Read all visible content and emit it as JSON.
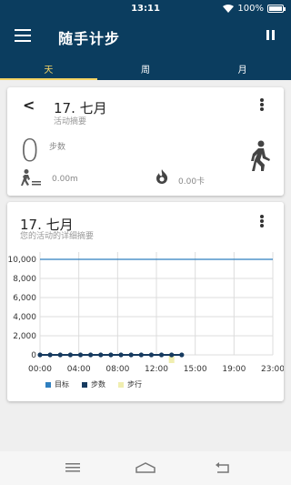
{
  "status": {
    "time": "13:11",
    "battery": "100%",
    "battery_level": 1.0
  },
  "app": {
    "title": "随手计步"
  },
  "tabs": [
    {
      "label": "天",
      "active": true
    },
    {
      "label": "周",
      "active": false
    },
    {
      "label": "月",
      "active": false
    }
  ],
  "summary": {
    "date": "17. 七月",
    "subtitle": "活动摘要",
    "steps": "0",
    "steps_unit": "步数",
    "distance": "0.00m",
    "calories": "0.00卡"
  },
  "detail": {
    "date": "17. 七月",
    "subtitle": "您的活动的详细摘要"
  },
  "colors": {
    "primary": "#0b3d5f",
    "accent": "#f5d565",
    "goal": "#2f7fbf",
    "steps": "#163a5f",
    "walking": "#f0eeb0"
  },
  "chart_data": {
    "type": "line",
    "x": [
      "00:00",
      "01:00",
      "02:00",
      "03:00",
      "04:00",
      "05:00",
      "06:00",
      "07:00",
      "08:00",
      "09:00",
      "10:00",
      "11:00",
      "12:00",
      "13:00",
      "14:00"
    ],
    "x_ticks": [
      "00:00",
      "04:00",
      "08:00",
      "12:00",
      "15:00",
      "19:00",
      "23:00"
    ],
    "y_ticks": [
      "0",
      "2,000",
      "4,000",
      "6,000",
      "8,000",
      "10,000"
    ],
    "ylim": [
      0,
      10000
    ],
    "grid": true,
    "series": [
      {
        "name": "目标",
        "values": [
          10000
        ],
        "color": "#2f7fbf"
      },
      {
        "name": "步数",
        "values": [
          0,
          0,
          0,
          0,
          0,
          0,
          0,
          0,
          0,
          0,
          0,
          0,
          0,
          0,
          0
        ],
        "color": "#163a5f"
      },
      {
        "name": "步行",
        "values": [
          0
        ],
        "color": "#f0eeb0"
      }
    ],
    "legend_placement": "bottom"
  }
}
